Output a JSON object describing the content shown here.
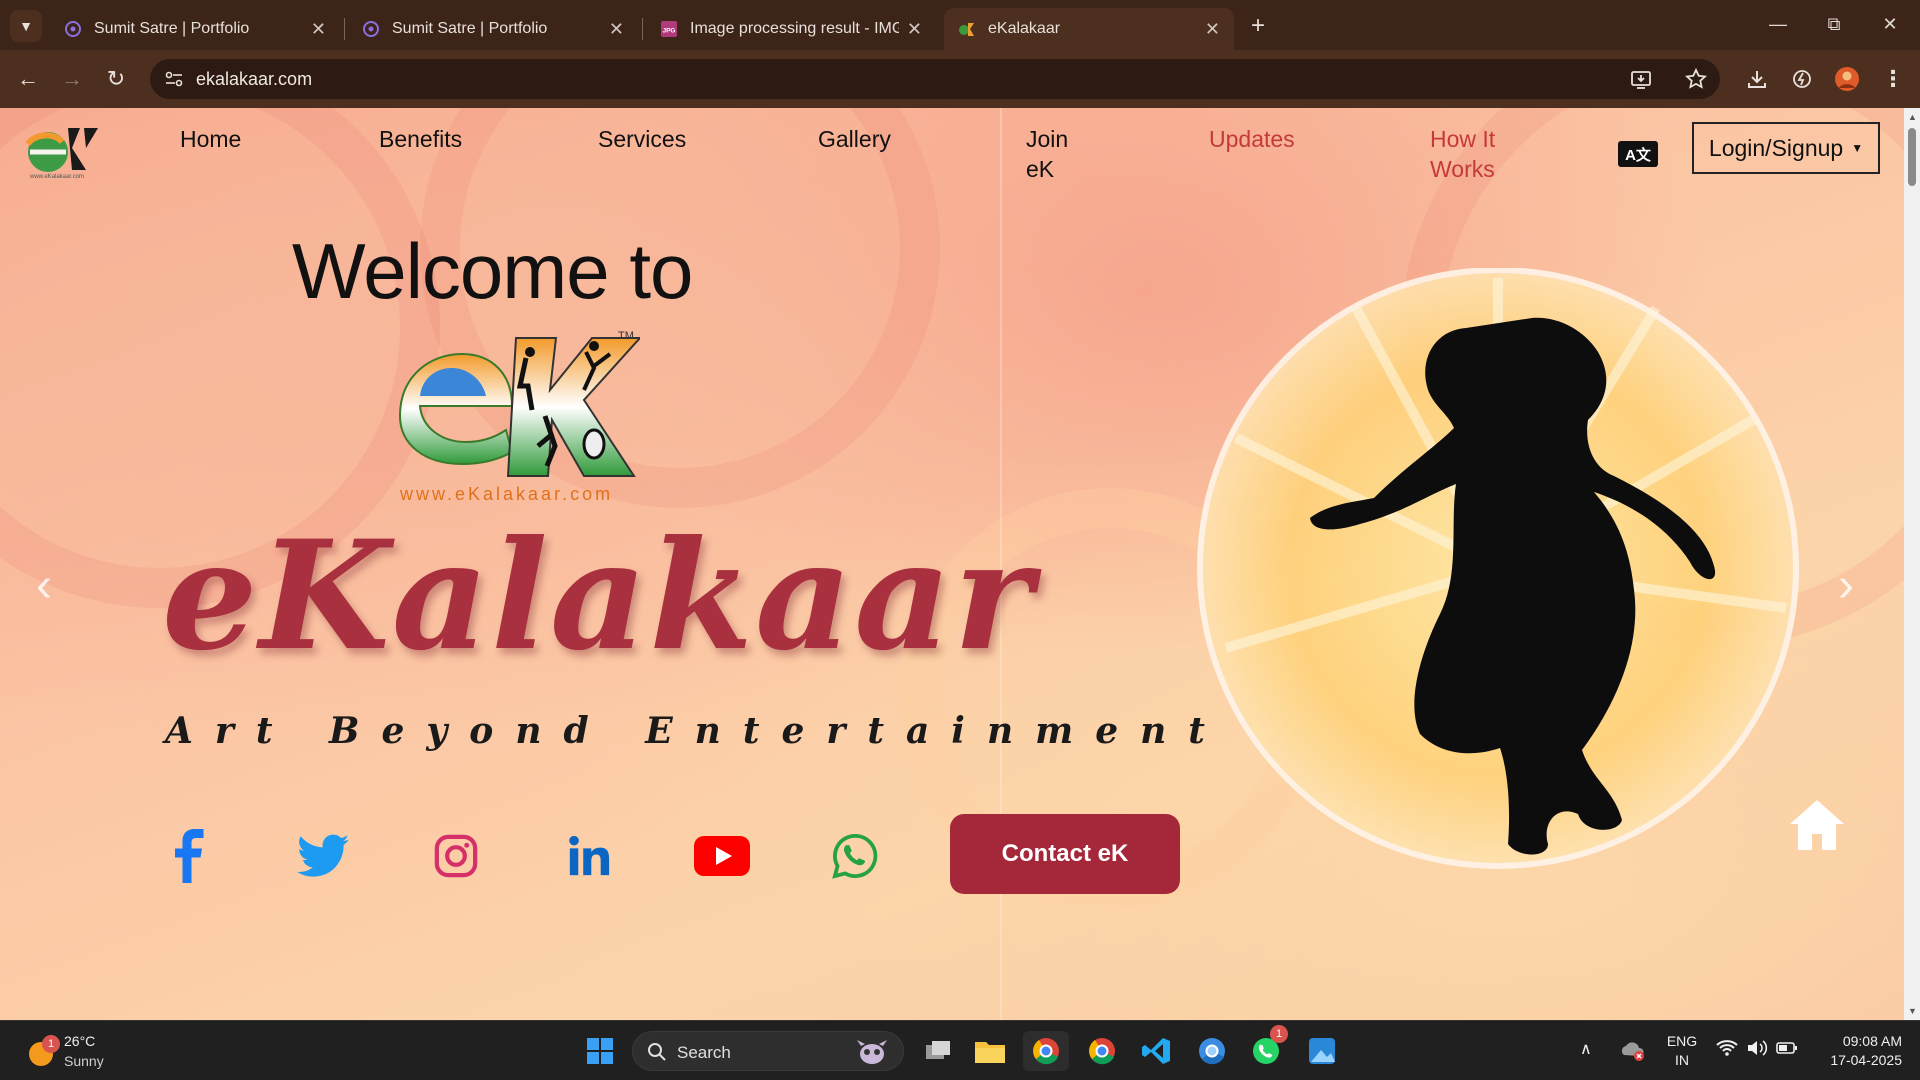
{
  "browser": {
    "tabs": [
      {
        "title": "Sumit Satre | Portfolio"
      },
      {
        "title": "Sumit Satre | Portfolio"
      },
      {
        "title": "Image processing result - IMG c"
      },
      {
        "title": "eKalakaar"
      }
    ],
    "url": "ekalakaar.com"
  },
  "site": {
    "logo_text": "eK",
    "logo_url_text": "www.eKalakaar.com",
    "nav": [
      {
        "label": "Home"
      },
      {
        "label": "Benefits"
      },
      {
        "label": "Services"
      },
      {
        "label": "Gallery"
      },
      {
        "label": "Join eK"
      },
      {
        "label": "Updates"
      },
      {
        "label": "How It Works"
      }
    ],
    "translate_icon": "A文",
    "login_label": "Login/Signup",
    "hero": {
      "welcome": "Welcome to",
      "trademark": "TM",
      "www": "www.eKalakaar.com",
      "brand": "eKalakaar",
      "tagline": "Art Beyond Entertainment",
      "contact_label": "Contact eK"
    },
    "social_icons": [
      "facebook-icon",
      "twitter-icon",
      "instagram-icon",
      "linkedin-icon",
      "youtube-icon",
      "whatsapp-icon"
    ],
    "colors": {
      "brand": "#a5283a",
      "highlight_nav": "#c43a3a"
    }
  },
  "taskbar": {
    "weather_temp": "26°C",
    "weather_desc": "Sunny",
    "weather_badge": "1",
    "search_label": "Search",
    "whatsapp_badge": "1",
    "lang_top": "ENG",
    "lang_bottom": "IN",
    "time": "09:08 AM",
    "date": "17-04-2025"
  }
}
